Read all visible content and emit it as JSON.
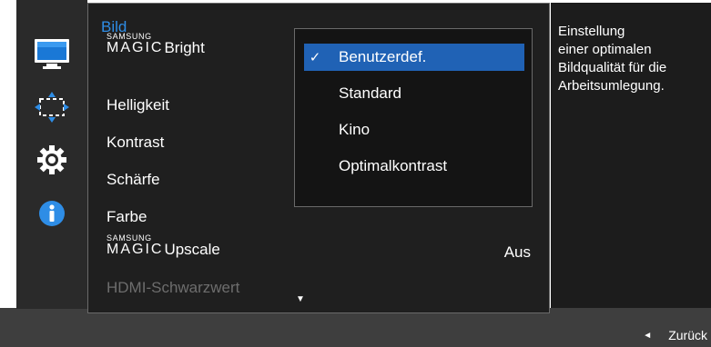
{
  "colors": {
    "accent": "#2e8de6",
    "selection": "#2062b5",
    "panel": "#1f1f1f",
    "background": "#2a2a2a",
    "bottom_bar": "#3e3e3e",
    "disabled": "#6d6d6d"
  },
  "sidebar": {
    "icons": [
      {
        "name": "picture-monitor-icon",
        "active": true
      },
      {
        "name": "screen-position-icon",
        "active": false
      },
      {
        "name": "system-gear-icon",
        "active": false
      },
      {
        "name": "information-icon",
        "active": false
      }
    ]
  },
  "menu": {
    "title": "Bild",
    "items": [
      {
        "magic_top": "SAMSUNG",
        "magic_bottom": "MAGIC",
        "label": "Bright",
        "selected": true
      },
      {
        "label": "Helligkeit"
      },
      {
        "label": "Kontrast"
      },
      {
        "label": "Schärfe"
      },
      {
        "label": "Farbe"
      },
      {
        "magic_top": "SAMSUNG",
        "magic_bottom": "MAGIC",
        "label": "Upscale",
        "value": "Aus"
      },
      {
        "label": "HDMI-Schwarzwert",
        "disabled": true
      }
    ],
    "scroll_indicator": "▼"
  },
  "submenu": {
    "options": [
      {
        "label": "Benutzerdef.",
        "checked": true,
        "check_mark": "✓"
      },
      {
        "label": "Standard"
      },
      {
        "label": "Kino"
      },
      {
        "label": "Optimalkontrast"
      }
    ]
  },
  "info": {
    "line1": "Einstellung",
    "line2": "einer optimalen",
    "line3": "Bildqualität für die",
    "line4": "Arbeitsumlegung."
  },
  "footer": {
    "back_icon": "◄",
    "back_label": "Zurück"
  }
}
